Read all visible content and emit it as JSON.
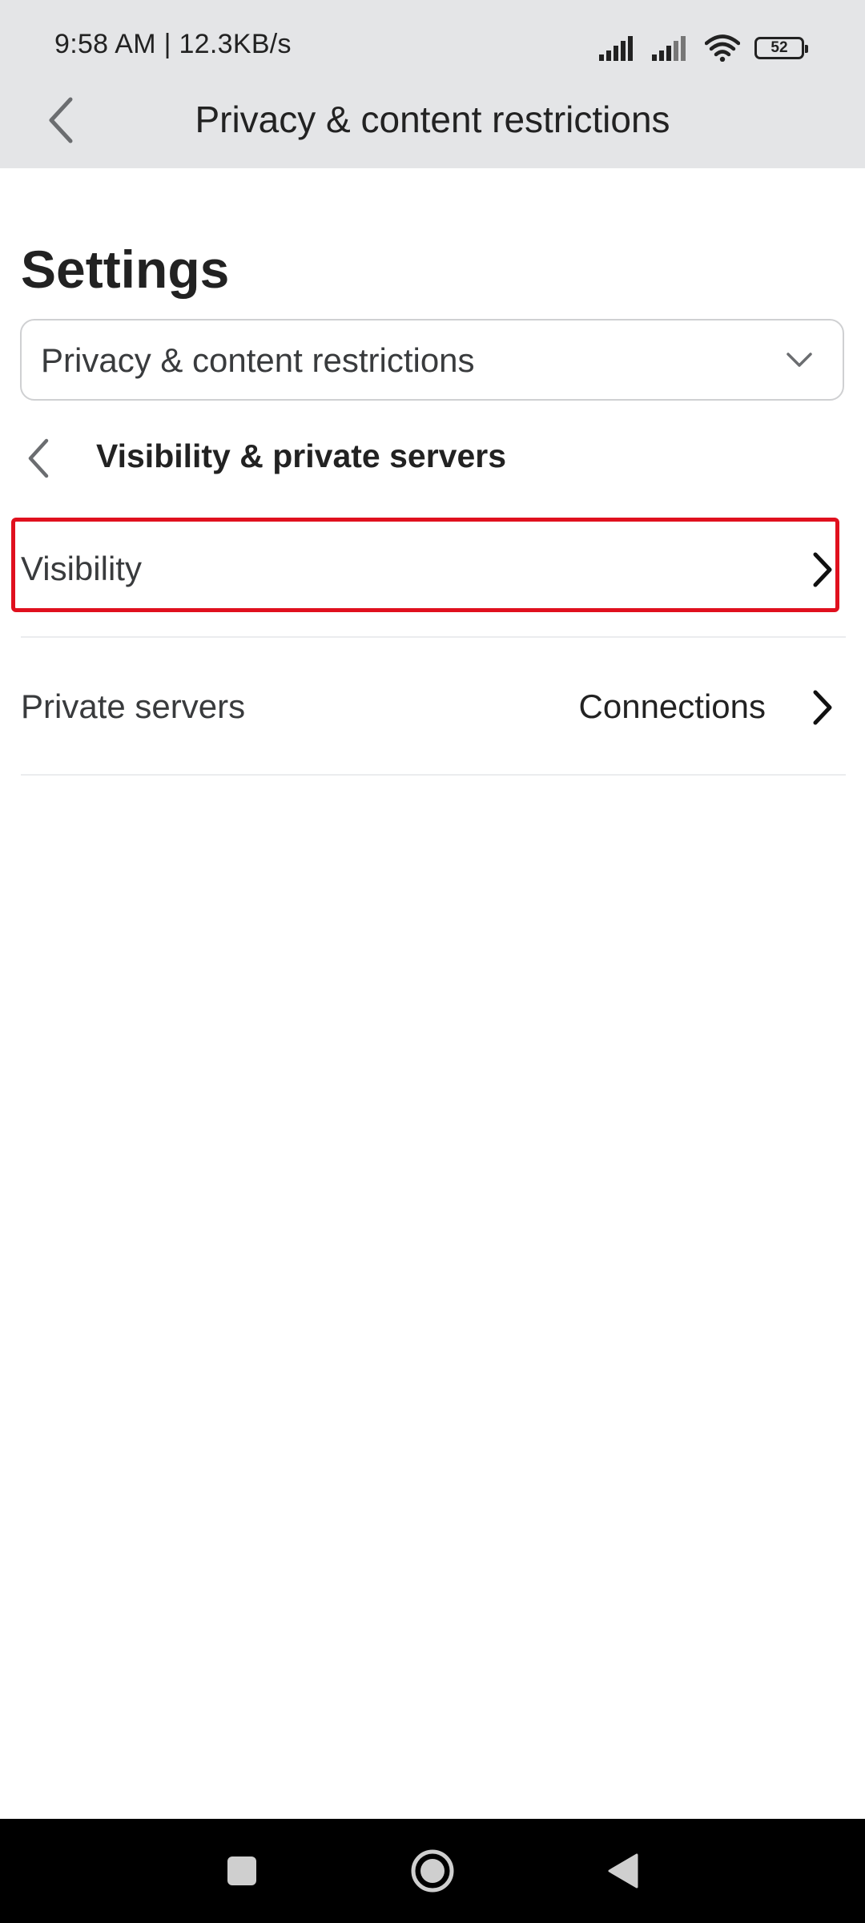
{
  "status_bar": {
    "time_speed": "9:58 AM | 12.3KB/s",
    "battery": "52",
    "icons": [
      "signal-icon",
      "signal-icon",
      "wifi-icon",
      "battery-icon"
    ]
  },
  "app_bar": {
    "back_icon": "back-arrow-icon",
    "title": "Privacy & content restrictions"
  },
  "page": {
    "heading": "Settings",
    "category_dropdown": {
      "selected": "Privacy & content restrictions",
      "icon": "chevron-down-icon"
    },
    "section": {
      "back_icon": "chevron-left-icon",
      "title": "Visibility & private servers"
    },
    "rows": [
      {
        "label": "Visibility",
        "value": "",
        "icon": "chevron-right-icon",
        "highlighted": true
      },
      {
        "label": "Private servers",
        "value": "Connections",
        "icon": "chevron-right-icon",
        "highlighted": false
      }
    ]
  },
  "system_nav": {
    "icons": [
      "recents-square-icon",
      "home-circle-icon",
      "back-triangle-icon"
    ]
  },
  "colors": {
    "app_bar_bg": "#e4e5e7",
    "highlight": "#e0101e",
    "divider": "#ebecee",
    "nav_bar_bg": "#000000"
  }
}
